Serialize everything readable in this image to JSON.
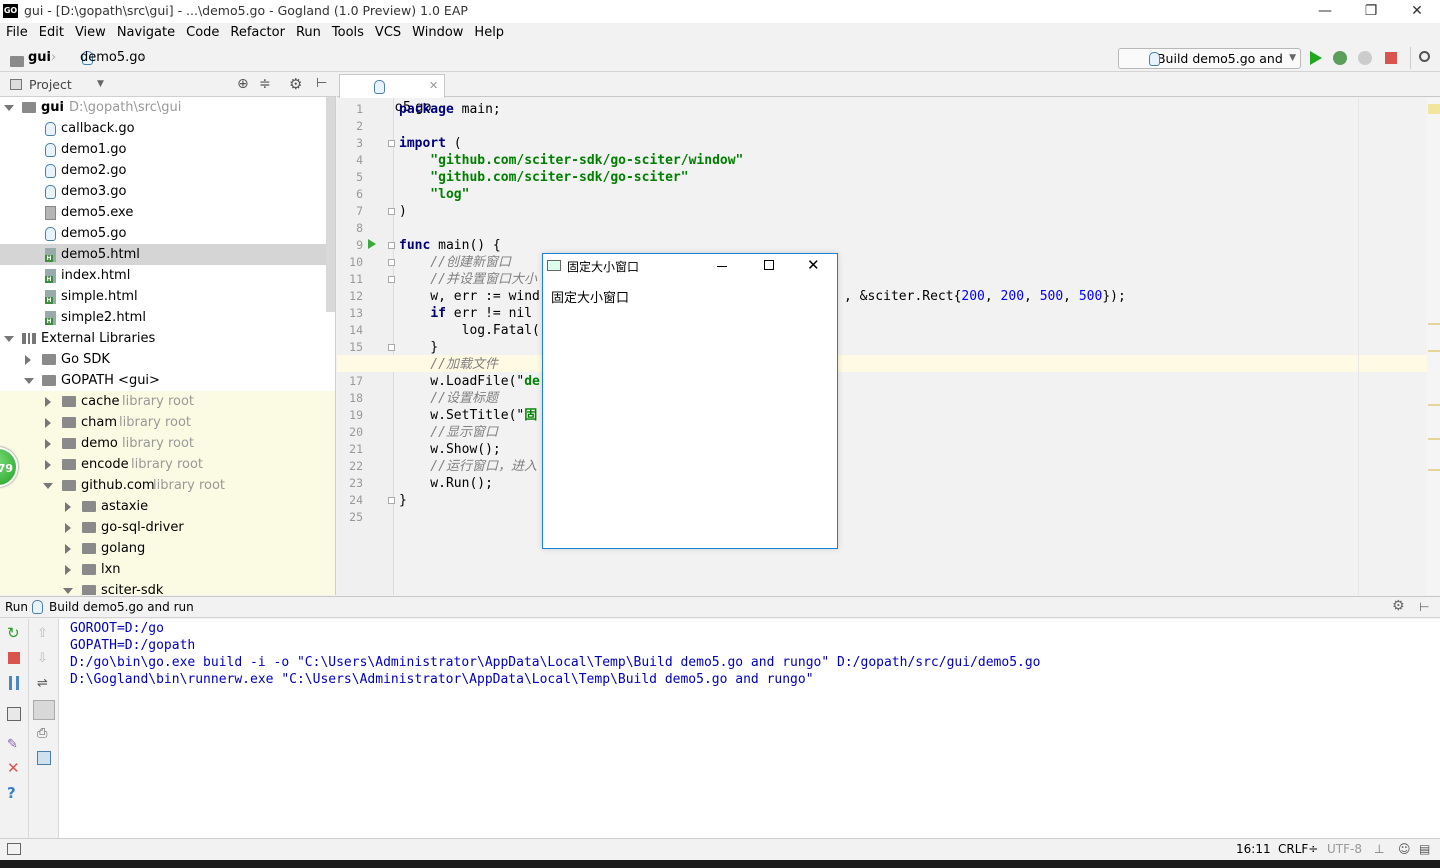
{
  "window": {
    "logo": "GO",
    "title": "gui - [D:\\gopath\\src\\gui] - ...\\demo5.go - Gogland (1.0 Preview) 1.0 EAP",
    "minimize": "—",
    "restore": "❐",
    "close": "✕"
  },
  "menu": [
    "File",
    "Edit",
    "View",
    "Navigate",
    "Code",
    "Refactor",
    "Run",
    "Tools",
    "VCS",
    "Window",
    "Help"
  ],
  "breadcrumb": {
    "project": "gui",
    "file": "demo5.go"
  },
  "run_config": "Build demo5.go and run",
  "project_panel": {
    "title": "Project"
  },
  "tree": {
    "root_name": "gui",
    "root_path": "D:\\gopath\\src\\gui",
    "files": [
      "callback.go",
      "demo1.go",
      "demo2.go",
      "demo3.go",
      "demo5.exe",
      "demo5.go",
      "demo5.html",
      "index.html",
      "simple.html",
      "simple2.html"
    ],
    "external": "External Libraries",
    "gosdk": "Go SDK",
    "gopath": "GOPATH <gui>",
    "libs": [
      {
        "name": "cache",
        "tag": "library root"
      },
      {
        "name": "cham",
        "tag": "library root"
      },
      {
        "name": "demo",
        "tag": "library root"
      },
      {
        "name": "encode",
        "tag": "library root"
      },
      {
        "name": "github.com",
        "tag": "library root"
      }
    ],
    "sub": [
      "astaxie",
      "go-sql-driver",
      "golang",
      "lxn",
      "sciter-sdk"
    ]
  },
  "badge": "79",
  "editor": {
    "tab": "demo5.go",
    "line_numbers": [
      "1",
      "2",
      "3",
      "4",
      "5",
      "6",
      "7",
      "8",
      "9",
      "10",
      "11",
      "12",
      "13",
      "14",
      "15",
      "16",
      "17",
      "18",
      "19",
      "20",
      "21",
      "22",
      "23",
      "24",
      "25"
    ],
    "code": {
      "l1_kw": "package",
      "l1_rest": " main;",
      "l3_kw": "import",
      "l3_rest": " (",
      "l4": "    \"github.com/sciter-sdk/go-sciter/window\"",
      "l5": "    \"github.com/sciter-sdk/go-sciter\"",
      "l6": "    \"log\"",
      "l7": ")",
      "l9_kw": "func",
      "l9_rest": " main() {",
      "l10": "    //创建新窗口",
      "l11": "    //并设置窗口大小",
      "l12_a": "    w, err := wind",
      "l12_b": ", &sciter.Rect{",
      "l12_n1": "200",
      "l12_c1": ", ",
      "l12_n2": "200",
      "l12_c2": ", ",
      "l12_n3": "500",
      "l12_c3": ", ",
      "l12_n4": "500",
      "l12_end": "});",
      "l13_a": "    ",
      "l13_kw": "if",
      "l13_b": " err != nil",
      "l14": "        log.Fatal(",
      "l15": "    }",
      "l16": "    //加载文件",
      "l17_a": "    w.LoadFile(\"",
      "l17_str": "de",
      "l18": "    //设置标题",
      "l19_a": "    w.SetTitle(\"",
      "l19_str": "固",
      "l20": "    //显示窗口",
      "l21": "    w.Show();",
      "l22": "    //运行窗口，进入",
      "l23": "    w.Run();",
      "l24": "}"
    }
  },
  "popup": {
    "title": "固定大小窗口",
    "body": "固定大小窗口"
  },
  "run_panel": {
    "label": "Run",
    "config": "Build demo5.go and run",
    "output": [
      "GOROOT=D:/go",
      "GOPATH=D:/gopath",
      "D:/go\\bin\\go.exe build -i -o \"C:\\Users\\Administrator\\AppData\\Local\\Temp\\Build demo5.go and rungo\" D:/gopath/src/gui/demo5.go",
      "D:\\Gogland\\bin\\runnerw.exe \"C:\\Users\\Administrator\\AppData\\Local\\Temp\\Build demo5.go and rungo\""
    ]
  },
  "status": {
    "position": "16:11",
    "line_sep": "CRLF÷",
    "encoding": "UTF-8"
  }
}
